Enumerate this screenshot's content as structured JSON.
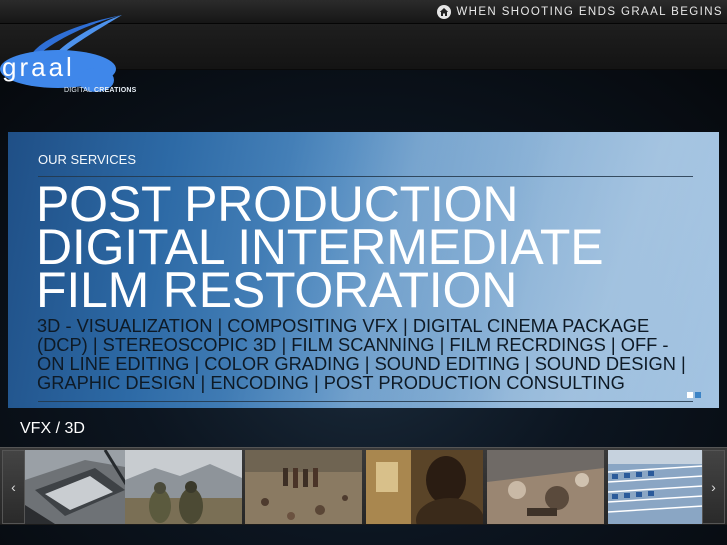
{
  "header": {
    "tagline": "WHEN SHOOTING ENDS GRAAL BEGINS",
    "logo_text": "graal",
    "logo_subtitle": "DIGITAL",
    "logo_subtitle_bold": "CREATIONS"
  },
  "slider": {
    "label": "OUR SERVICES",
    "headlines": [
      "POST PRODUCTION",
      "DIGITAL INTERMEDIATE",
      "FILM RESTORATION"
    ],
    "services_text": "3D - VISUALIZATION | COMPOSITING VFX | DIGITAL CINEMA PACKAGE (DCP) | STEREOSCOPIC 3D | FILM SCANNING | FILM RECRDINGS | OFF - ON LINE EDITING | COLOR GRADING | SOUND EDITING | SOUND DESIGN | GRAPHIC DESIGN | ENCODING | POST PRODUCTION CONSULTING"
  },
  "gallery": {
    "title": "VFX / 3D",
    "prev_arrow": "‹",
    "next_arrow": "›"
  }
}
